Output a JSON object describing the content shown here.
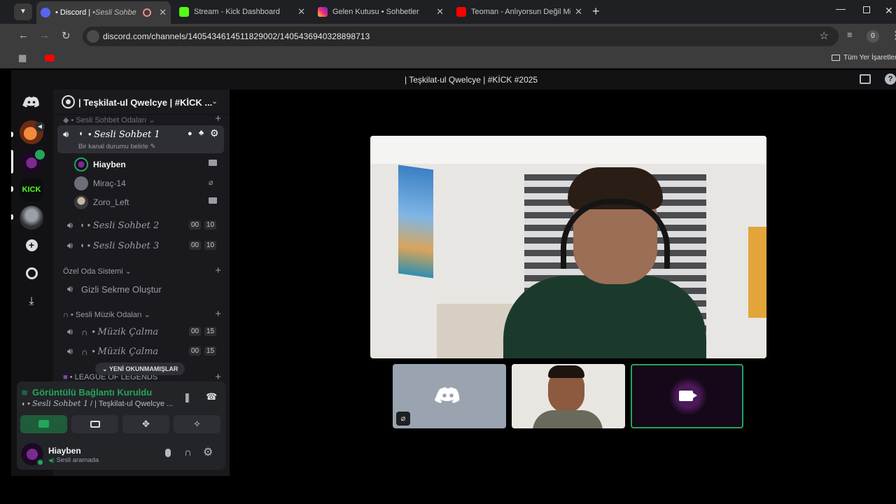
{
  "browser": {
    "tabs": [
      {
        "title": "• Discord | ",
        "title_italic": "•Sesli Sohbe",
        "active": true
      },
      {
        "title": "Stream - Kick Dashboard",
        "active": false
      },
      {
        "title": "Gelen Kutusu • Sohbetler",
        "active": false
      },
      {
        "title": "Teoman - Anlıyorsun Değil Mi (",
        "active": false
      }
    ],
    "url": "discord.com/channels/1405434614511829002/1405436940328898713",
    "extension_badge": "0",
    "bookmarks_folder": "Tüm Yer İşaretleri"
  },
  "discord": {
    "title_bar": "| Teşkilat-ul Qwelcye | #KİCK #2025",
    "server_name": "| Teşkilat-ul Qwelcye | #KİCK ...",
    "kick_server_label": "KICK",
    "categories": {
      "voice": "• Sesli Sohbet Odaları",
      "private": "Özel Oda Sistemi",
      "music": "• Sesli Müzik Odaları",
      "league": "• LEAGUE OF LEGENDS"
    },
    "active_channel": {
      "name": "Sesli Sohbet 1",
      "prefix": "•",
      "status": "Bir kanal durumu belirle"
    },
    "members": [
      "Hiayben",
      "Miraç-14",
      "Zoro_Left"
    ],
    "channels": [
      {
        "name": "Sesli Sohbet 2",
        "count": "00",
        "limit": "10"
      },
      {
        "name": "Sesli Sohbet 3",
        "count": "00",
        "limit": "10"
      }
    ],
    "private_channel": "Gizli Sekme Oluştur",
    "music_channels": [
      {
        "name": "Müzik Çalma",
        "count": "00",
        "limit": "15"
      },
      {
        "name": "Müzik Çalma",
        "count": "00",
        "limit": "15"
      }
    ],
    "unread_pill": "YENİ OKUNMAMIŞLAR",
    "voice_panel": {
      "status": "Görüntülü Bağlantı Kuruldu",
      "channel_italic": "Sesli Sohbet 1",
      "channel_rest": " / | Teşkilat-ul Qwelcye ..."
    },
    "user_panel": {
      "name": "Hiayben",
      "status": "Sesli aramada"
    }
  },
  "colors": {
    "accent_green": "#23a55a",
    "status_green": "#3ba55d",
    "kick_green": "#53fc18",
    "blurple": "#5865f2",
    "youtube_red": "#ff0000"
  }
}
